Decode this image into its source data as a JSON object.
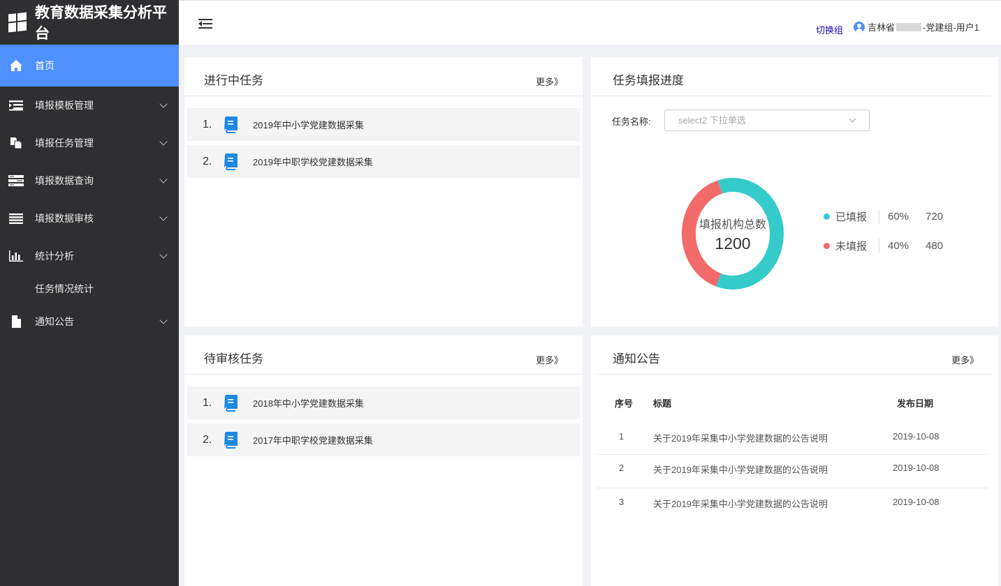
{
  "app": {
    "title": "教育数据采集分析平台"
  },
  "sidebar": {
    "items": [
      {
        "label": "首页",
        "icon": "home-icon"
      },
      {
        "label": "填报模板管理",
        "icon": "template-icon"
      },
      {
        "label": "填报任务管理",
        "icon": "copy-icon"
      },
      {
        "label": "填报数据查询",
        "icon": "query-icon"
      },
      {
        "label": "填报数据审核",
        "icon": "list-icon"
      },
      {
        "label": "统计分析",
        "icon": "bar-chart-icon"
      }
    ],
    "sub_item": "任务情况统计",
    "last_item": {
      "label": "通知公告",
      "icon": "file-icon"
    }
  },
  "header": {
    "switch_group": "切换组",
    "user_prefix": "吉林省",
    "user_suffix": "-党建组-用户1"
  },
  "in_progress": {
    "title": "进行中任务",
    "more": "更多》",
    "tasks": [
      {
        "num": "1.",
        "name": "2019年中小学党建数据采集"
      },
      {
        "num": "2.",
        "name": "2019年中职学校党建数据采集"
      }
    ]
  },
  "progress": {
    "title": "任务填报进度",
    "filter_label": "任务名称:",
    "select_placeholder": "select2 下拉单选",
    "center_label": "填报机构总数",
    "total": "1200"
  },
  "chart_data": {
    "type": "pie",
    "categories": [
      "已填报",
      "未填报"
    ],
    "values": [
      720,
      480
    ],
    "percent_labels": [
      "60%",
      "40%"
    ],
    "colors": [
      "#36cbcb",
      "#f36a6a"
    ],
    "total": 1200,
    "legend_position": "right"
  },
  "pending": {
    "title": "待审核任务",
    "more": "更多》",
    "tasks": [
      {
        "num": "1.",
        "name": "2018年中小学党建数据采集"
      },
      {
        "num": "2.",
        "name": "2017年中职学校党建数据采集"
      }
    ]
  },
  "notice": {
    "title": "通知公告",
    "more": "更多》",
    "headers": [
      "序号",
      "标题",
      "发布日期"
    ],
    "rows": [
      {
        "no": "1",
        "title": "关于2019年采集中小学党建数据的公告说明",
        "date": "2019-10-08"
      },
      {
        "no": "2",
        "title": "关于2019年采集中小学党建数据的公告说明",
        "date": "2019-10-08"
      },
      {
        "no": "3",
        "title": "关于2019年采集中小学党建数据的公告说明",
        "date": "2019-10-08"
      }
    ]
  }
}
